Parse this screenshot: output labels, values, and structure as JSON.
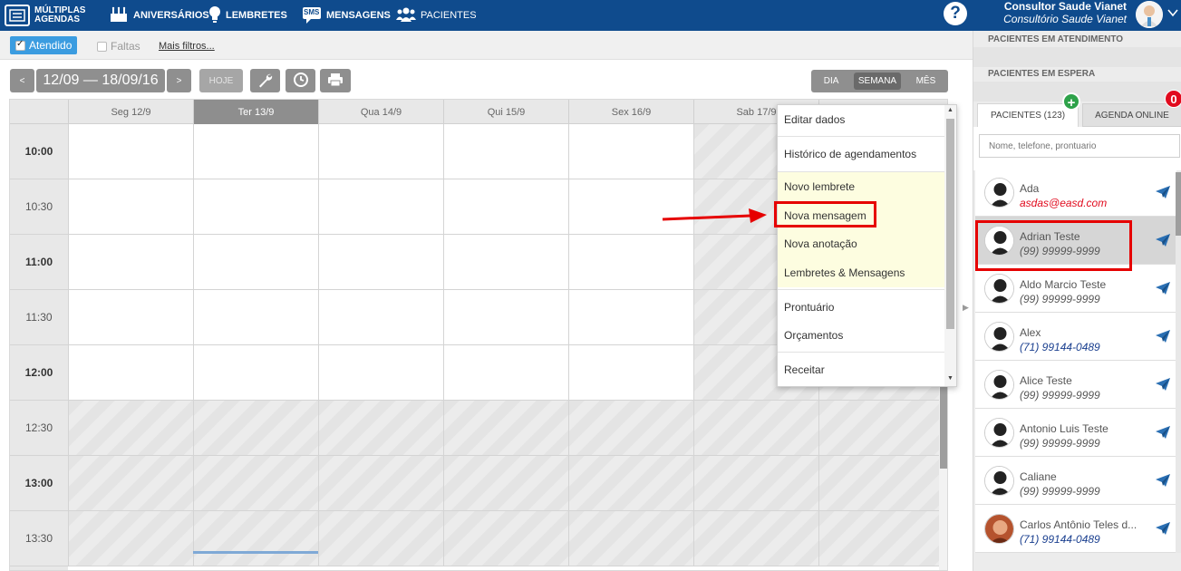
{
  "topnav": {
    "logo_line1": "MÚLTIPLAS",
    "logo_line2": "AGENDAS",
    "aniversarios": "ANIVERSÁRIOS",
    "lembretes": "LEMBRETES",
    "sms_badge": "SMS",
    "mensagens": "MENSAGENS",
    "pacientes": "PACIENTES",
    "help": "?",
    "user_name": "Consultor Saude Vianet",
    "clinic_name": "Consultório Saude Vianet"
  },
  "filters": {
    "atendido": "Atendido",
    "faltas": "Faltas",
    "mais_filtros": "Mais filtros..."
  },
  "toolbar": {
    "prev": "<",
    "date_range": "12/09 — 18/09/16",
    "next": ">",
    "hoje": "HOJE",
    "views": [
      "DIA",
      "SEMANA",
      "MÊS"
    ],
    "active_view": "SEMANA"
  },
  "calendar": {
    "days": [
      "Seg 12/9",
      "Ter 13/9",
      "Qua 14/9",
      "Qui 15/9",
      "Sex 16/9",
      "Sab 17/9",
      ""
    ],
    "today_index": 1,
    "times": [
      "10:00",
      "10:30",
      "11:00",
      "11:30",
      "12:00",
      "12:30",
      "13:00",
      "13:30"
    ]
  },
  "context_menu": {
    "items": [
      "Editar dados",
      "Histórico de agendamentos",
      "Novo lembrete",
      "Nova mensagem",
      "Nova anotação",
      "Lembretes & Mensagens",
      "Prontuário",
      "Orçamentos",
      "Receitar"
    ]
  },
  "sidebar": {
    "em_atendimento": "PACIENTES EM ATENDIMENTO",
    "em_espera": "PACIENTES EM ESPERA",
    "tab_pacientes": "PACIENTES (123)",
    "tab_agenda_online": "AGENDA ONLINE",
    "plus": "+",
    "badge_count": "0",
    "search_placeholder": "Nome, telefone, prontuario",
    "patients": [
      {
        "name": "Ada",
        "sub": "asdas@easd.com",
        "style": "red"
      },
      {
        "name": "Adrian Teste",
        "sub": "(99) 99999-9999",
        "style": "gray"
      },
      {
        "name": "Aldo Marcio Teste",
        "sub": "(99) 99999-9999",
        "style": "gray"
      },
      {
        "name": "Alex",
        "sub": "(71) 99144-0489",
        "style": "blue"
      },
      {
        "name": "Alice Teste",
        "sub": "(99) 99999-9999",
        "style": "gray"
      },
      {
        "name": "Antonio Luis Teste",
        "sub": "(99) 99999-9999",
        "style": "gray"
      },
      {
        "name": "Caliane",
        "sub": "(99) 99999-9999",
        "style": "gray"
      },
      {
        "name": "Carlos Antônio Teles d...",
        "sub": "(71) 99144-0489",
        "style": "blue"
      }
    ]
  },
  "colors": {
    "nav_blue": "#0f4b8d",
    "accent_blue": "#3b9ce0",
    "highlight_red": "#e60000",
    "send_blue": "#2a6fb3"
  },
  "icons": [
    "agenda-icon",
    "cake-icon",
    "bulb-icon",
    "sms-icon",
    "people-icon",
    "help-icon",
    "chevron-down-icon",
    "wrench-icon",
    "clock-icon",
    "print-icon",
    "send-icon",
    "avatar-silhouette-icon",
    "plus-icon"
  ]
}
